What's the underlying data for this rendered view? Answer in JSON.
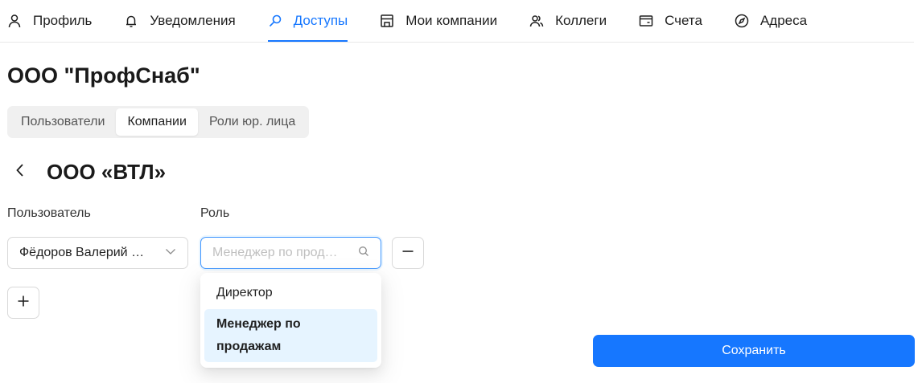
{
  "nav": {
    "items": [
      {
        "label": "Профиль",
        "icon": "user-icon"
      },
      {
        "label": "Уведомления",
        "icon": "bell-icon"
      },
      {
        "label": "Доступы",
        "icon": "key-icon"
      },
      {
        "label": "Мои компании",
        "icon": "shop-icon"
      },
      {
        "label": "Коллеги",
        "icon": "team-icon"
      },
      {
        "label": "Счета",
        "icon": "wallet-icon"
      },
      {
        "label": "Адреса",
        "icon": "compass-icon"
      }
    ],
    "active_index": 2
  },
  "company": {
    "title": "ООО \"ПрофСнаб\""
  },
  "tabs": {
    "items": [
      "Пользователи",
      "Компании",
      "Роли юр. лица"
    ],
    "active_index": 1
  },
  "sub": {
    "title": "ООО «ВТЛ»"
  },
  "form": {
    "user_label": "Пользователь",
    "role_label": "Роль",
    "user_value": "Фёдоров Валерий …",
    "role_placeholder": "Менеджер по прод…"
  },
  "dropdown": {
    "options": [
      "Директор",
      "Менеджер по продажам"
    ],
    "selected_index": 1
  },
  "actions": {
    "save_label": "Сохранить"
  },
  "colors": {
    "accent": "#1677ff",
    "selected_bg": "#e6f4ff"
  }
}
